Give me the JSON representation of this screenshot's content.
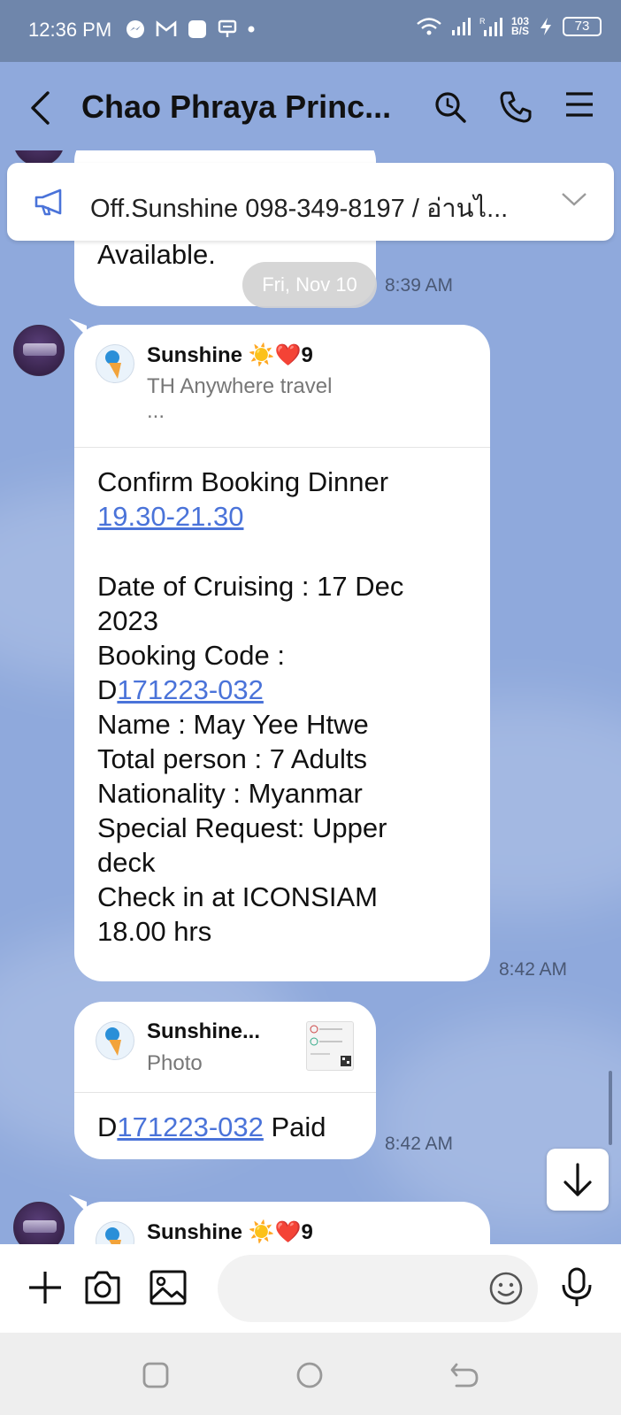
{
  "status_bar": {
    "time": "12:36 PM",
    "net_speed_top": "103",
    "net_speed_bottom": "B/S",
    "battery": "73"
  },
  "header": {
    "title": "Chao Phraya Princ..."
  },
  "announcement": {
    "text": "Off.Sunshine  098-349-8197 / อ่านไ..."
  },
  "messages": {
    "m1": {
      "text": "Available.",
      "time": "8:39 AM"
    },
    "date_pill": "Fri, Nov 10",
    "m2": {
      "quote_sender": "Sunshine ☀️❤️9",
      "quote_sub": "TH Anywhere travel",
      "quote_more": "...",
      "line1": "Confirm Booking  Dinner",
      "line2_link": "19.30-21.30",
      "line3": "Date of Cruising : 17 Dec",
      "line4": "2023",
      "line5": "Booking Code :",
      "line6_prefix": "D",
      "line6_link": "171223-032",
      "line7": "Name : May Yee Htwe",
      "line8": "Total person : 7 Adults",
      "line9": "Nationality : Myanmar",
      "line10": "Special Request: Upper",
      "line11": "deck",
      "line12": "Check in at ICONSIAM",
      "line13": "18.00 hrs",
      "time": "8:42 AM"
    },
    "m3": {
      "quote_sender": "Sunshine...",
      "quote_sub": "Photo",
      "prefix": "D",
      "link": "171223-032",
      "suffix": " Paid",
      "time": "8:42 AM"
    },
    "m4": {
      "quote_sender": "Sunshine ☀️❤️9"
    }
  },
  "colors": {
    "chat_bg": "#8fa9dc",
    "status_bg": "#6f86ab",
    "link": "#4a73d9"
  }
}
